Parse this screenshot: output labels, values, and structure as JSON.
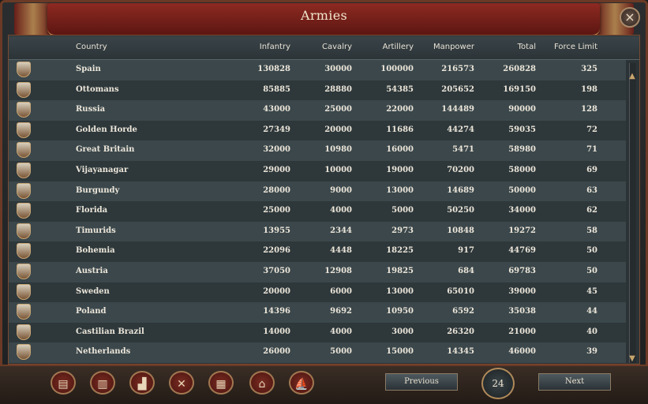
{
  "window": {
    "title": "Armies",
    "close_label": "×"
  },
  "columns": [
    "Country",
    "Infantry",
    "Cavalry",
    "Artillery",
    "Manpower",
    "Total",
    "Force Limit"
  ],
  "rows": [
    {
      "country": "Spain",
      "infantry": "130828",
      "cavalry": "30000",
      "artillery": "100000",
      "manpower": "216573",
      "total": "260828",
      "force_limit": "325"
    },
    {
      "country": "Ottomans",
      "infantry": "85885",
      "cavalry": "28880",
      "artillery": "54385",
      "manpower": "205652",
      "total": "169150",
      "force_limit": "198"
    },
    {
      "country": "Russia",
      "infantry": "43000",
      "cavalry": "25000",
      "artillery": "22000",
      "manpower": "144489",
      "total": "90000",
      "force_limit": "128"
    },
    {
      "country": "Golden Horde",
      "infantry": "27349",
      "cavalry": "20000",
      "artillery": "11686",
      "manpower": "44274",
      "total": "59035",
      "force_limit": "72"
    },
    {
      "country": "Great Britain",
      "infantry": "32000",
      "cavalry": "10980",
      "artillery": "16000",
      "manpower": "5471",
      "total": "58980",
      "force_limit": "71"
    },
    {
      "country": "Vijayanagar",
      "infantry": "29000",
      "cavalry": "10000",
      "artillery": "19000",
      "manpower": "70200",
      "total": "58000",
      "force_limit": "69"
    },
    {
      "country": "Burgundy",
      "infantry": "28000",
      "cavalry": "9000",
      "artillery": "13000",
      "manpower": "14689",
      "total": "50000",
      "force_limit": "63"
    },
    {
      "country": "Florida",
      "infantry": "25000",
      "cavalry": "4000",
      "artillery": "5000",
      "manpower": "50250",
      "total": "34000",
      "force_limit": "62"
    },
    {
      "country": "Timurids",
      "infantry": "13955",
      "cavalry": "2344",
      "artillery": "2973",
      "manpower": "10848",
      "total": "19272",
      "force_limit": "58"
    },
    {
      "country": "Bohemia",
      "infantry": "22096",
      "cavalry": "4448",
      "artillery": "18225",
      "manpower": "917",
      "total": "44769",
      "force_limit": "50"
    },
    {
      "country": "Austria",
      "infantry": "37050",
      "cavalry": "12908",
      "artillery": "19825",
      "manpower": "684",
      "total": "69783",
      "force_limit": "50"
    },
    {
      "country": "Sweden",
      "infantry": "20000",
      "cavalry": "6000",
      "artillery": "13000",
      "manpower": "65010",
      "total": "39000",
      "force_limit": "45"
    },
    {
      "country": "Poland",
      "infantry": "14396",
      "cavalry": "9692",
      "artillery": "10950",
      "manpower": "6592",
      "total": "35038",
      "force_limit": "44"
    },
    {
      "country": "Castilian Brazil",
      "infantry": "14000",
      "cavalry": "4000",
      "artillery": "3000",
      "manpower": "26320",
      "total": "21000",
      "force_limit": "40"
    },
    {
      "country": "Netherlands",
      "infantry": "26000",
      "cavalry": "5000",
      "artillery": "15000",
      "manpower": "14345",
      "total": "46000",
      "force_limit": "39"
    }
  ],
  "footer": {
    "tabs": [
      "ledger-icon",
      "buildings-icon",
      "economy-icon",
      "crossed-swords-icon",
      "coins-icon",
      "city-icon",
      "ship-icon"
    ],
    "previous_label": "Previous",
    "next_label": "Next",
    "page": "24"
  }
}
